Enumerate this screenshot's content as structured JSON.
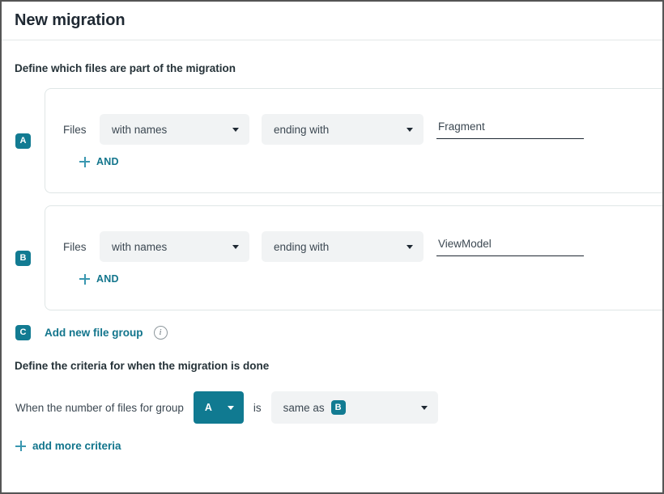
{
  "header": {
    "title": "New migration"
  },
  "files_section": {
    "heading": "Define which files are part of the migration",
    "groups": [
      {
        "badge": "A",
        "files_label": "Files",
        "attribute": "with names",
        "operator": "ending with",
        "value": "Fragment",
        "value_placeholder": "",
        "and_label": "AND"
      },
      {
        "badge": "B",
        "files_label": "Files",
        "attribute": "with names",
        "operator": "ending with",
        "value": "ViewModel",
        "value_placeholder": "",
        "and_label": "AND"
      }
    ],
    "add_group": {
      "badge": "C",
      "label": "Add new file group",
      "info_glyph": "i"
    }
  },
  "criteria_section": {
    "heading": "Define the criteria for when the migration is done",
    "prefix_text": "When the number of files for group",
    "group_select": "A",
    "middle_text": "is",
    "comparison_text": "same as",
    "comparison_badge": "B",
    "add_criteria_label": "add more criteria"
  },
  "colors": {
    "accent_teal": "#127b92",
    "link_teal": "#12758c",
    "plus_teal": "#3a97b0",
    "select_bg": "#f1f3f4",
    "card_border": "#dfe6e6",
    "text_dark": "#1f2933",
    "page_border": "#555555"
  }
}
